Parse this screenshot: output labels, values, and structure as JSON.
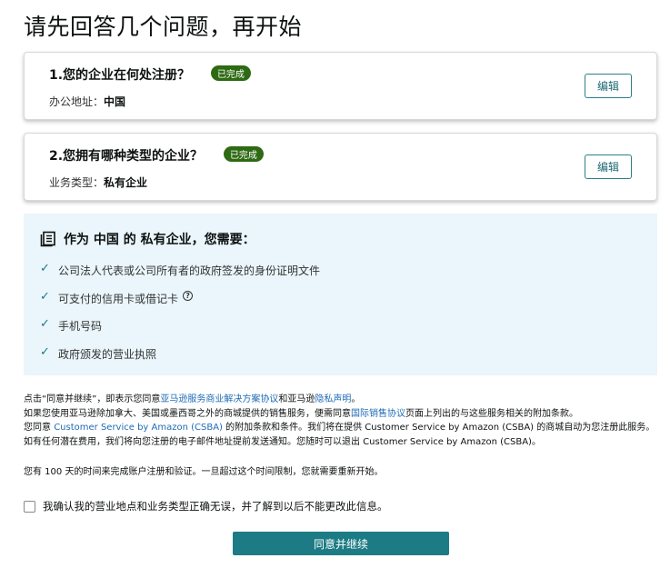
{
  "page_title": "请先回答几个问题，再开始",
  "questions": [
    {
      "label": "1.您的企业在何处注册？",
      "status": "已完成",
      "answer_label": "办公地址：",
      "answer_value": "中国",
      "edit_label": "编辑"
    },
    {
      "label": "2.您拥有哪种类型的企业？",
      "status": "已完成",
      "answer_label": "业务类型：",
      "answer_value": "私有企业",
      "edit_label": "编辑"
    }
  ],
  "requirements": {
    "heading": "作为 中国 的 私有企业，您需要：",
    "items": [
      "公司法人代表或公司所有者的政府签发的身份证明文件",
      "可支付的信用卡或借记卡",
      "手机号码",
      "政府颁发的营业执照"
    ],
    "info_glyph": "?"
  },
  "legal": {
    "l1_a": "点击“同意并继续”，即表示您同意",
    "l1_link1": "亚马逊服务商业解决方案协议",
    "l1_b": "和亚马逊",
    "l1_link2": "隐私声明",
    "l1_c": "。",
    "l2_a": "如果您使用亚马逊除加拿大、美国或墨西哥之外的商城提供的销售服务，便需同意",
    "l2_link": "国际销售协议",
    "l2_b": "页面上列出的与这些服务相关的附加条款。",
    "l3_a": "您同意 ",
    "l3_link": "Customer Service by Amazon (CSBA)",
    "l3_b": " 的附加条款和条件。我们将在提供 Customer Service by Amazon (CSBA) 的商城自动为您注册此服务。如有任何潜在费用，我们将向您注册的电子邮件地址提前发送通知。您随时可以退出 Customer Service by Amazon (CSBA)。"
  },
  "days_notice": "您有 100 天的时间来完成账户注册和验证。一旦超过这个时间限制，您就需要重新开始。",
  "confirm_text": "我确认我的营业地点和业务类型正确无误，并了解到以后不能更改此信息。",
  "confirm_checked": false,
  "agree_button": "同意并继续",
  "colors": {
    "accent": "#1c7b84",
    "badge": "#2e6a13",
    "link": "#1f6bb5",
    "panel": "#eaf6fb"
  }
}
